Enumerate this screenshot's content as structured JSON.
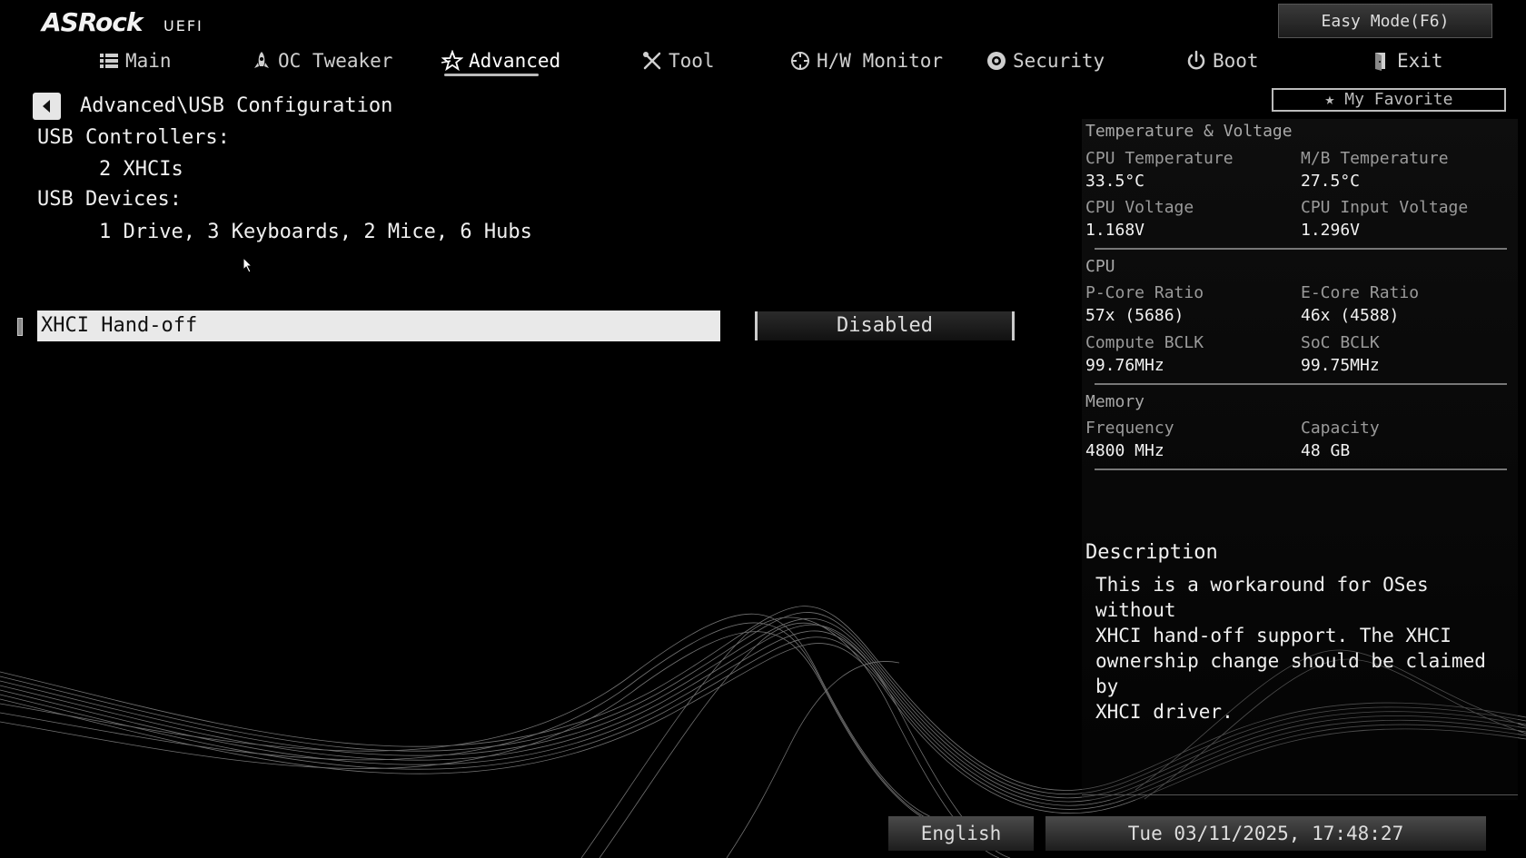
{
  "header": {
    "logo_brand": "ASRock",
    "logo_sub": "UEFI",
    "easy_mode_label": "Easy Mode(F6)"
  },
  "tabs": [
    {
      "label": "Main",
      "icon": "list-icon",
      "active": false
    },
    {
      "label": "OC Tweaker",
      "icon": "rocket-icon",
      "active": false
    },
    {
      "label": "Advanced",
      "icon": "star-icon",
      "active": true
    },
    {
      "label": "Tool",
      "icon": "tools-icon",
      "active": false
    },
    {
      "label": "H/W Monitor",
      "icon": "crosshair-icon",
      "active": false
    },
    {
      "label": "Security",
      "icon": "shield-icon",
      "active": false
    },
    {
      "label": "Boot",
      "icon": "power-icon",
      "active": false
    },
    {
      "label": "Exit",
      "icon": "exit-door-icon",
      "active": false
    }
  ],
  "breadcrumb": "Advanced\\USB Configuration",
  "content": {
    "usb_controllers_label": "USB Controllers:",
    "usb_controllers_value": "2 XHCIs",
    "usb_devices_label": "USB Devices:",
    "usb_devices_value": "1 Drive, 3 Keyboards, 2 Mice, 6 Hubs",
    "setting_label": "XHCI Hand-off",
    "setting_value": "Disabled"
  },
  "favorite_label": "My Favorite",
  "monitor": {
    "temp_voltage": {
      "title": "Temperature & Voltage",
      "cpu_temp_label": "CPU Temperature",
      "cpu_temp_value": "33.5°C",
      "mb_temp_label": "M/B Temperature",
      "mb_temp_value": "27.5°C",
      "cpu_voltage_label": "CPU Voltage",
      "cpu_voltage_value": "1.168V",
      "cpu_input_voltage_label": "CPU Input Voltage",
      "cpu_input_voltage_value": "1.296V"
    },
    "cpu": {
      "title": "CPU",
      "pcore_label": "P-Core Ratio",
      "pcore_value": "57x (5686)",
      "ecore_label": "E-Core Ratio",
      "ecore_value": "46x (4588)",
      "compute_bclk_label": "Compute BCLK",
      "compute_bclk_value": "99.76MHz",
      "soc_bclk_label": "SoC BCLK",
      "soc_bclk_value": "99.75MHz"
    },
    "memory": {
      "title": "Memory",
      "freq_label": "Frequency",
      "freq_value": "4800 MHz",
      "cap_label": "Capacity",
      "cap_value": "48 GB"
    }
  },
  "description": {
    "title": "Description",
    "text": "This is a workaround for OSes without\nXHCI hand-off support. The XHCI\nownership change should be claimed by\nXHCI driver."
  },
  "footer": {
    "language": "English",
    "datetime": "Tue 03/11/2025, 17:48:27"
  }
}
